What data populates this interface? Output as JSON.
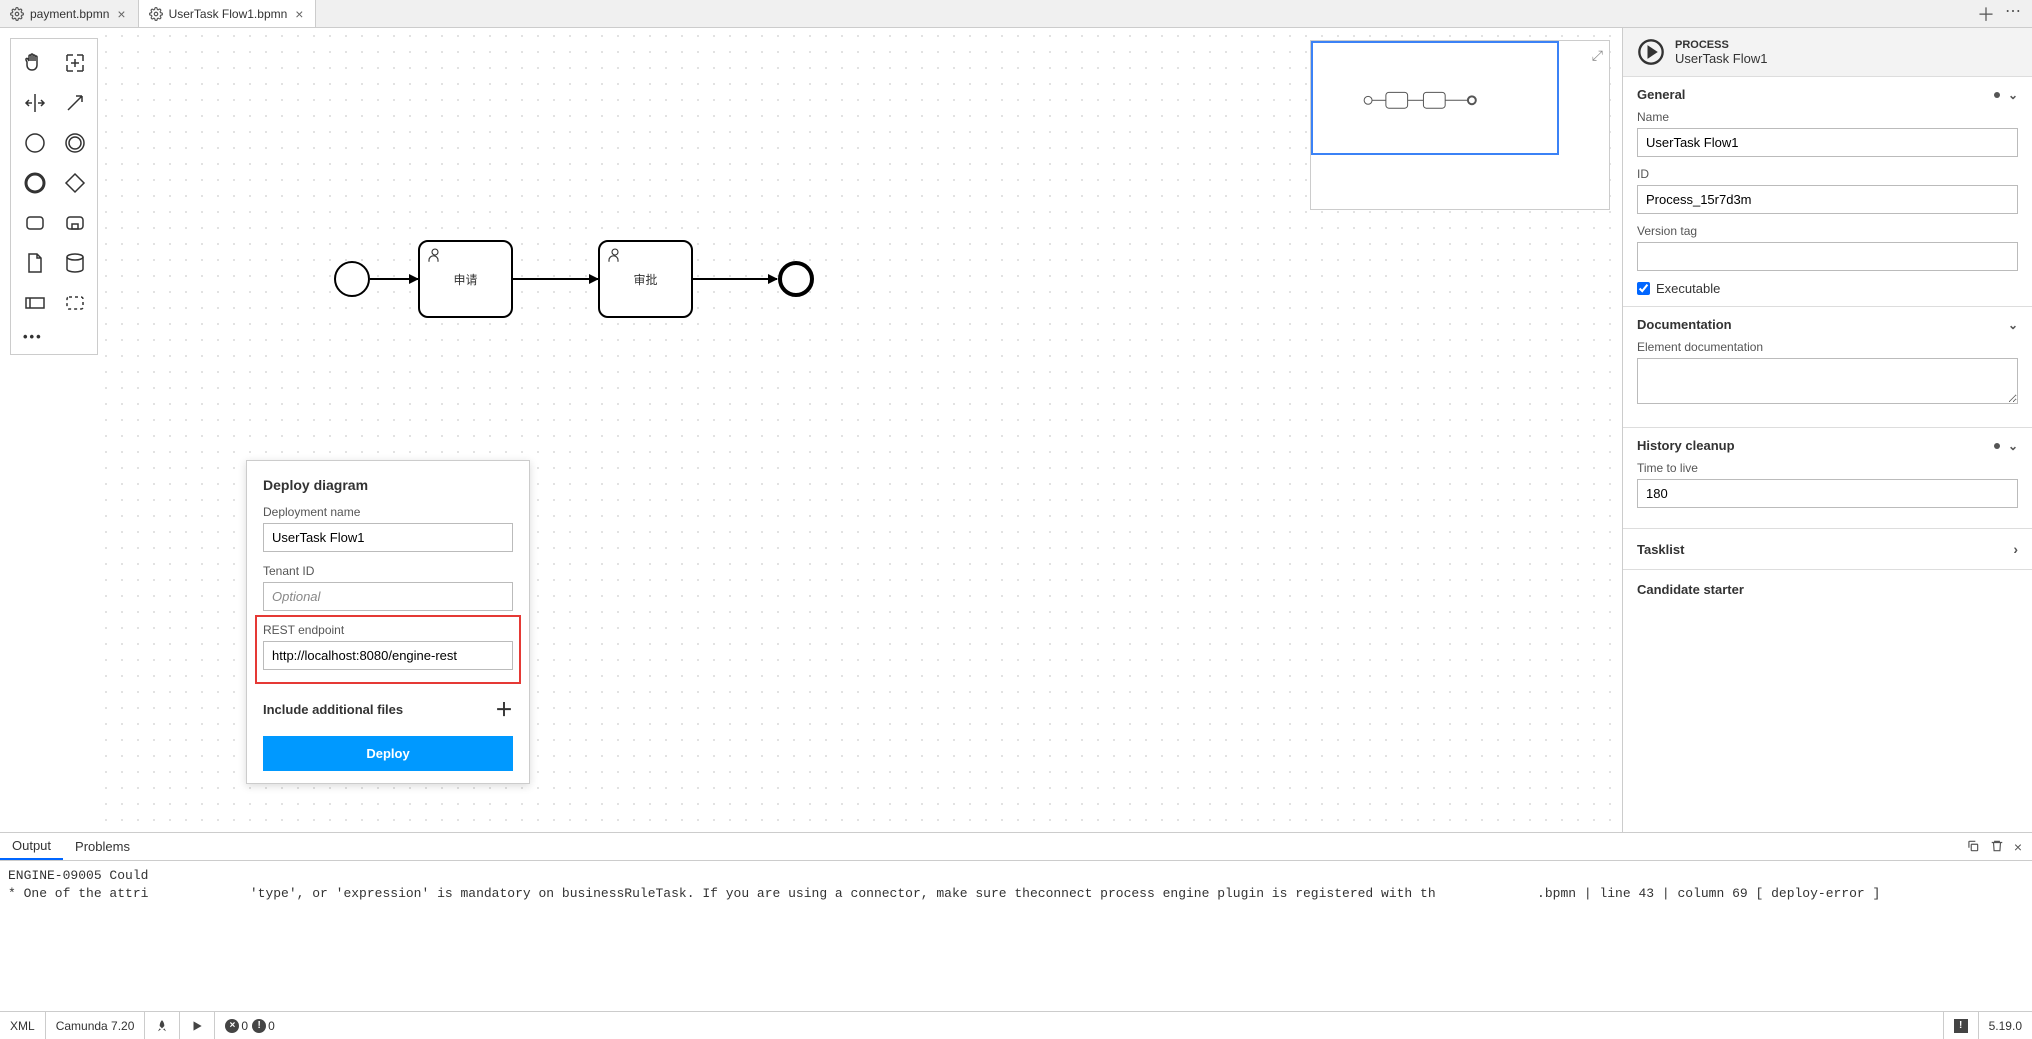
{
  "tabs": [
    {
      "label": "payment.bpmn",
      "active": false
    },
    {
      "label": "UserTask Flow1.bpmn",
      "active": true
    }
  ],
  "diagram": {
    "task1": "申请",
    "task2": "审批"
  },
  "panel": {
    "header_label": "PROCESS",
    "header_title": "UserTask Flow1",
    "sections": {
      "general": {
        "title": "General",
        "name_label": "Name",
        "name_value": "UserTask Flow1",
        "id_label": "ID",
        "id_value": "Process_15r7d3m",
        "version_label": "Version tag",
        "version_value": "",
        "executable_label": "Executable",
        "executable_checked": true
      },
      "documentation": {
        "title": "Documentation",
        "doc_label": "Element documentation",
        "doc_value": ""
      },
      "history": {
        "title": "History cleanup",
        "ttl_label": "Time to live",
        "ttl_value": "180"
      },
      "tasklist": {
        "title": "Tasklist"
      },
      "candidate": {
        "title": "Candidate starter"
      }
    }
  },
  "deploy": {
    "title": "Deploy diagram",
    "name_label": "Deployment name",
    "name_value": "UserTask Flow1",
    "tenant_label": "Tenant ID",
    "tenant_placeholder": "Optional",
    "rest_label": "REST endpoint",
    "rest_value": "http://localhost:8080/engine-rest",
    "include_label": "Include additional files",
    "button": "Deploy"
  },
  "output": {
    "tab_output": "Output",
    "tab_problems": "Problems",
    "content": "ENGINE-09005 Could\n* One of the attri             'type', or 'expression' is mandatory on businessRuleTask. If you are using a connector, make sure theconnect process engine plugin is registered with th             .bpmn | line 43 | column 69 [ deploy-error ]"
  },
  "statusbar": {
    "xml": "XML",
    "engine": "Camunda 7.20",
    "error_count": "0",
    "warn_count": "0",
    "version": "5.19.0"
  }
}
